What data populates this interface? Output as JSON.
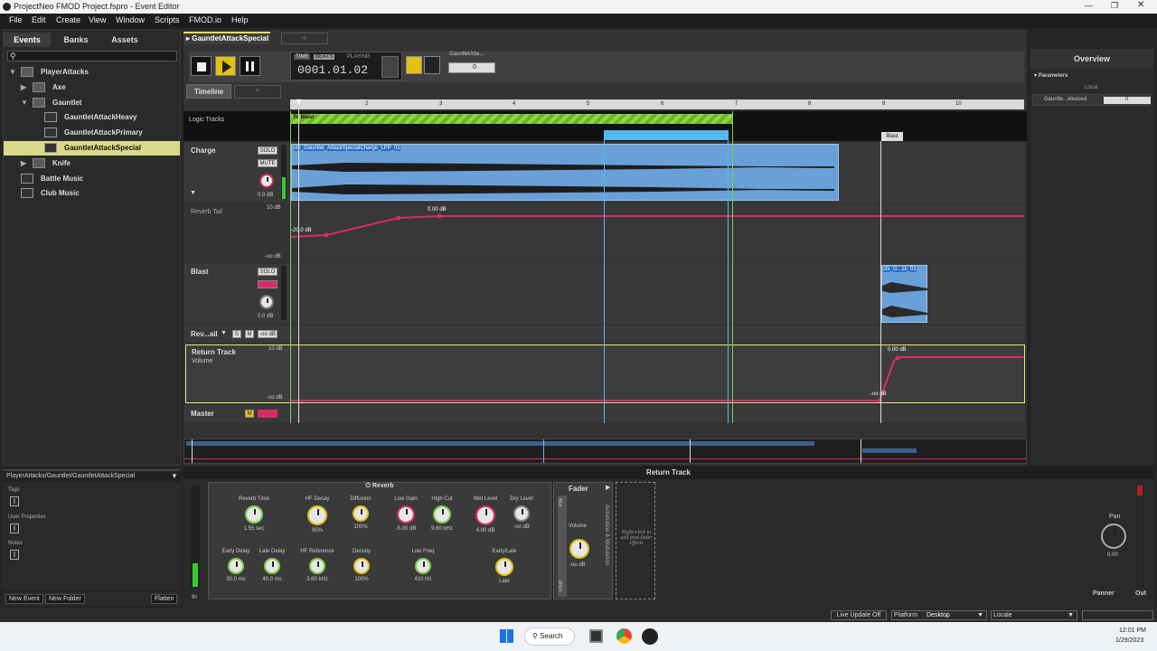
{
  "window": {
    "title": "ProjectNeo FMOD Project.fspro - Event Editor"
  },
  "menu": [
    "File",
    "Edit",
    "Create",
    "View",
    "Window",
    "Scripts",
    "FMOD.io",
    "Help"
  ],
  "browser": {
    "tabs": [
      "Events",
      "Banks",
      "Assets"
    ],
    "tree": [
      {
        "label": "PlayerAttacks",
        "depth": 0,
        "type": "folder",
        "expanded": true
      },
      {
        "label": "Axe",
        "depth": 1,
        "type": "folder",
        "expanded": false
      },
      {
        "label": "Gauntlet",
        "depth": 1,
        "type": "folder",
        "expanded": true
      },
      {
        "label": "GauntletAttackHeavy",
        "depth": 2,
        "type": "event"
      },
      {
        "label": "GauntletAttackPrimary",
        "depth": 2,
        "type": "event"
      },
      {
        "label": "GauntletAttackSpecial",
        "depth": 2,
        "type": "event",
        "selected": true
      },
      {
        "label": "Knife",
        "depth": 1,
        "type": "folder",
        "expanded": false
      },
      {
        "label": "Battle Music",
        "depth": 0,
        "type": "event"
      },
      {
        "label": "Club Music",
        "depth": 0,
        "type": "event"
      }
    ],
    "path": "PlayerAttacks/Gauntlet/GauntletAttackSpecial",
    "props": [
      "Tags",
      "User Properties",
      "Notes"
    ],
    "buttons": {
      "new_event": "New Event",
      "new_folder": "New Folder",
      "flatten": "Flatten"
    }
  },
  "editor": {
    "event_tab": "GauntletAttackSpecial",
    "transport": {
      "time": "TIME",
      "beats": "BEATS",
      "status": "PLAYING",
      "position": "0001.01.02",
      "param_name": "GauntletAtta...",
      "param_value": "0"
    },
    "timeline_tab": "Timeline",
    "ruler": [
      "2",
      "3",
      "4",
      "5",
      "6",
      "7",
      "8",
      "9",
      "10"
    ],
    "logic_tracks": "Logic Tracks",
    "marker_to_blast": "To Blast",
    "marker_blast": "Blast",
    "tracks": {
      "charge": {
        "name": "Charge",
        "solo": "SOLO",
        "mute": "MUTE",
        "gain": "0.0 dB",
        "region": "sfx_Gauntlet_AttackSpecialCharge_LPP_01"
      },
      "reverb_tail": {
        "name": "Reverb Tail",
        "top": "10 dB",
        "bottom": "-oo dB",
        "start": "-20.0 dB",
        "peak": "0.00 dB"
      },
      "blast": {
        "name": "Blast",
        "solo": "SOLO",
        "mute": "MUTE",
        "gain": "0.0 dB",
        "region": "sfx_G...ss_01"
      },
      "rev_tail": {
        "name": "Rev...ail",
        "s": "S",
        "m": "M",
        "vol": "-oo dB"
      },
      "return": {
        "name": "Return Track",
        "sub": "Volume",
        "top": "10 dB",
        "bottom": "-oo dB",
        "peak": "0.00 dB",
        "start": "-oo dB"
      },
      "master": {
        "name": "Master",
        "m": "M"
      }
    }
  },
  "overview": {
    "title": "Overview",
    "parameters": "Parameters",
    "local": "Local",
    "param": "Gauntle...eleased",
    "value": "0"
  },
  "deck": {
    "title": "Return Track",
    "reverb": {
      "title": "Reverb",
      "knobs": [
        {
          "label": "Reverb Time",
          "value": "1.55 sec"
        },
        {
          "label": "HF Decay",
          "value": "95%"
        },
        {
          "label": "Diffusion",
          "value": "100%"
        },
        {
          "label": "Low Gain",
          "value": "-5.00 dB"
        },
        {
          "label": "High Cut",
          "value": "9.60 kHz"
        },
        {
          "label": "Wet Level",
          "value": "4.00 dB"
        },
        {
          "label": "Dry Level",
          "value": "-oo dB"
        },
        {
          "label": "Early Delay",
          "value": "20.0 ms"
        },
        {
          "label": "Late Delay",
          "value": "40.0 ms"
        },
        {
          "label": "HF Reference",
          "value": "3.60 kHz"
        },
        {
          "label": "Density",
          "value": "100%"
        },
        {
          "label": "Low Freq",
          "value": "410 Hz"
        },
        {
          "label": "Early/Late",
          "value": "Late"
        }
      ]
    },
    "fader": {
      "title": "Fader",
      "pre": "Pre",
      "post": "Post",
      "volume": "Volume",
      "value": "-oo dB",
      "automation": "Automation & Modulation"
    },
    "hint": "Right-click to add post-fader effects",
    "in": "In",
    "pan": "Pan",
    "pan_value": "0.00",
    "panner": "Panner",
    "out": "Out"
  },
  "status": {
    "live": "Live Update Off",
    "platform_label": "Platform",
    "platform": "Desktop",
    "locale": "Locale"
  },
  "taskbar": {
    "search": "Search",
    "time": "12:01 PM",
    "date": "1/29/2023"
  }
}
